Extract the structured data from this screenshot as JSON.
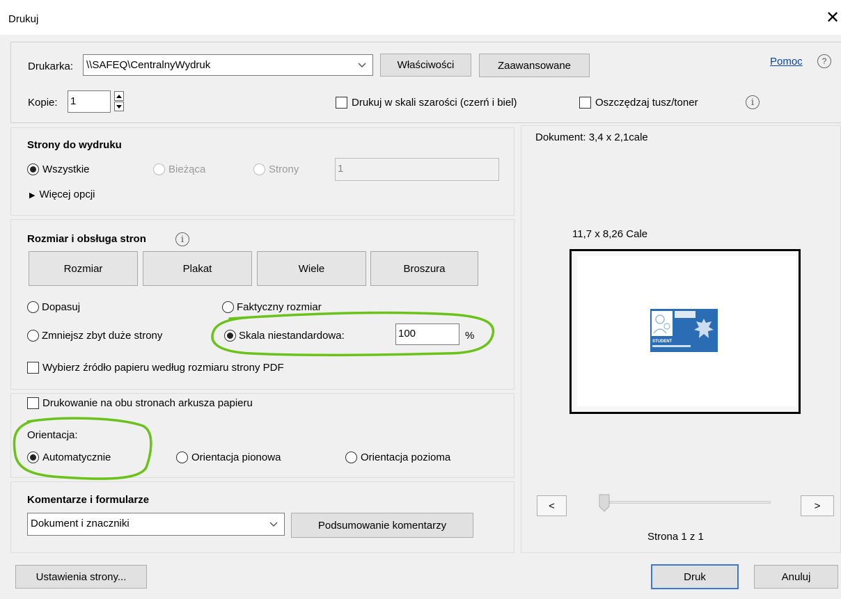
{
  "window": {
    "title": "Drukuj",
    "close_icon": "close-icon"
  },
  "help": {
    "label": "Pomoc",
    "icon": "question-circle-icon"
  },
  "printer": {
    "label": "Drukarka:",
    "value": "\\\\SAFEQ\\CentralnyWydruk",
    "properties_button": "Właściwości",
    "advanced_button": "Zaawansowane"
  },
  "copies": {
    "label": "Kopie:",
    "value": "1"
  },
  "options": {
    "grayscale": {
      "label": "Drukuj w skali szarości (czerń i biel)",
      "checked": false
    },
    "save_ink": {
      "label": "Oszczędzaj tusz/toner",
      "checked": false
    }
  },
  "pages": {
    "title": "Strony do wydruku",
    "all": "Wszystkie",
    "current": "Bieżąca",
    "pages": "Strony",
    "pages_input": "1",
    "more_options": "Więcej opcji",
    "selected": "all"
  },
  "sizing": {
    "title": "Rozmiar i obsługa stron",
    "buttons": [
      "Rozmiar",
      "Plakat",
      "Wiele",
      "Broszura"
    ],
    "fit": "Dopasuj",
    "actual_size": "Faktyczny rozmiar",
    "shrink": "Zmniejsz zbyt duże strony",
    "custom_scale": "Skala niestandardowa:",
    "scale_value": "100",
    "scale_unit": "%",
    "paper_source": "Wybierz źródło papieru według rozmiaru strony PDF",
    "selected": "custom_scale"
  },
  "duplex": {
    "label": "Drukowanie na obu stronach arkusza papieru",
    "checked": false
  },
  "orientation": {
    "label": "Orientacja:",
    "auto": "Automatycznie",
    "portrait": "Orientacja pionowa",
    "landscape": "Orientacja pozioma",
    "selected": "auto"
  },
  "comments": {
    "title": "Komentarze i formularze",
    "value": "Dokument i znaczniki",
    "summary_button": "Podsumowanie komentarzy"
  },
  "preview": {
    "document_size": "Dokument: 3,4 x 2,1cale",
    "paper_size": "11,7 x 8,26 Cale",
    "prev": "<",
    "next": ">",
    "page_label": "Strona 1 z 1",
    "card_text": "STUDENT"
  },
  "footer": {
    "page_setup": "Ustawienia strony...",
    "print": "Druk",
    "cancel": "Anuluj"
  },
  "colors": {
    "highlight": "#6bc21a",
    "card_blue": "#2a6db5",
    "link": "#0645ad"
  }
}
